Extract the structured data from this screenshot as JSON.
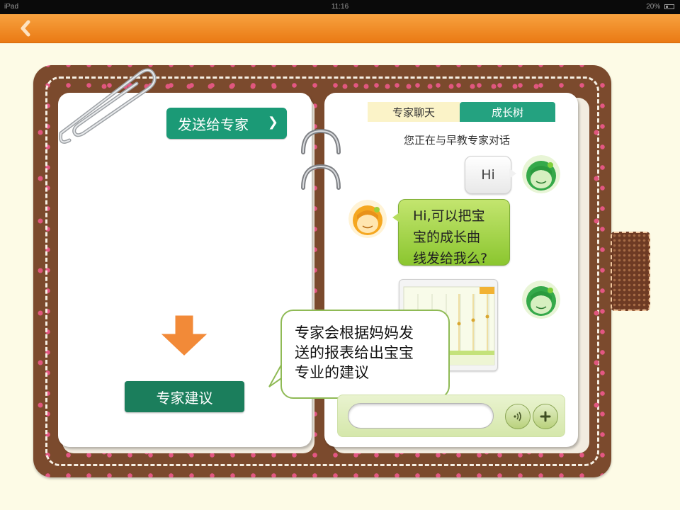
{
  "status_bar": {
    "device": "iPad",
    "time": "11:16",
    "battery": "20%"
  },
  "nav": {
    "back_icon": "chevron-left-icon"
  },
  "left_page": {
    "send_button_label": "发送给专家",
    "send_button_chevron": "❯",
    "expert_advice_label": "专家建议",
    "arrow_icon": "arrow-down-icon",
    "clip_icon": "paperclip-icon"
  },
  "right_page": {
    "tabs": [
      {
        "label": "专家聊天",
        "active": false
      },
      {
        "label": "成长树",
        "active": true
      }
    ],
    "chat_header": "您正在与早教专家对话",
    "messages": [
      {
        "from": "user",
        "text": "Hi"
      },
      {
        "from": "expert",
        "lines": [
          "Hi,可以把宝",
          "宝的成长曲",
          "线发给我么?"
        ]
      },
      {
        "from": "user",
        "type": "chart-image"
      }
    ],
    "input_placeholder": "",
    "voice_icon": "voice-icon",
    "add_icon": "plus-icon"
  },
  "callout": {
    "lines": [
      "专家会根据妈妈发",
      "送的报表给出宝宝",
      "专业的建议"
    ]
  },
  "colors": {
    "nav_orange": "#f08c25",
    "leather_brown": "#7b4a2d",
    "primary_green": "#1b9a76",
    "bubble_green": "#9fd23e"
  }
}
